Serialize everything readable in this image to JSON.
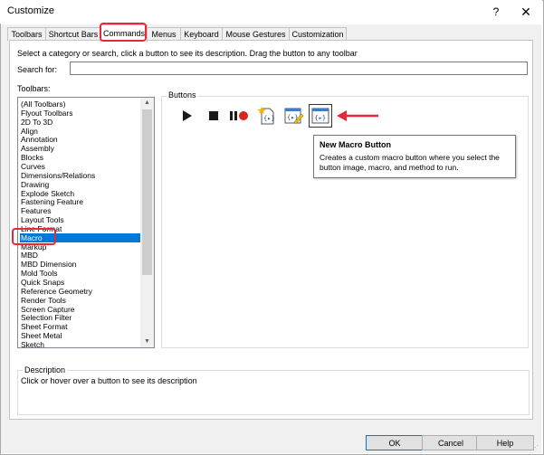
{
  "window": {
    "title": "Customize",
    "help_glyph": "?",
    "close_glyph": "✕"
  },
  "tabs": [
    {
      "label": "Toolbars"
    },
    {
      "label": "Shortcut Bars"
    },
    {
      "label": "Commands"
    },
    {
      "label": "Menus"
    },
    {
      "label": "Keyboard"
    },
    {
      "label": "Mouse Gestures"
    },
    {
      "label": "Customization"
    }
  ],
  "active_tab": "Commands",
  "commands": {
    "instructions": "Select a category or search, click a button to see its description. Drag the button to any toolbar",
    "search_label": "Search for:",
    "search_value": "",
    "toolbars_label": "Toolbars:",
    "toolbars": [
      "(All Toolbars)",
      "Flyout Toolbars",
      "2D To 3D",
      "Align",
      "Annotation",
      "Assembly",
      "Blocks",
      "Curves",
      "Dimensions/Relations",
      "Drawing",
      "Explode Sketch",
      "Fastening Feature",
      "Features",
      "Layout Tools",
      "Line Format",
      "Macro",
      "Markup",
      "MBD",
      "MBD Dimension",
      "Mold Tools",
      "Quick Snaps",
      "Reference Geometry",
      "Render Tools",
      "Screen Capture",
      "Selection Filter",
      "Sheet Format",
      "Sheet Metal",
      "Sketch"
    ],
    "selected_toolbar": "Macro",
    "buttons_label": "Buttons",
    "buttons": [
      {
        "icon": "run-macro-icon"
      },
      {
        "icon": "stop-macro-icon"
      },
      {
        "icon": "pause-record-macro-icon"
      },
      {
        "icon": "new-macro-icon"
      },
      {
        "icon": "edit-macro-icon"
      },
      {
        "icon": "new-macro-button-icon"
      }
    ],
    "tooltip": {
      "title": "New Macro Button",
      "description": "Creates a custom macro button where you select the button image, macro, and method to run."
    },
    "description_label": "Description",
    "description_text": "Click or hover over a button to see its description"
  },
  "footer": {
    "ok_label": "OK",
    "cancel_label": "Cancel",
    "help_label": "Help"
  },
  "colors": {
    "annotation_red": "#e8283a",
    "selection_blue": "#0078d7",
    "dialog_gray": "#f0f0f0"
  }
}
